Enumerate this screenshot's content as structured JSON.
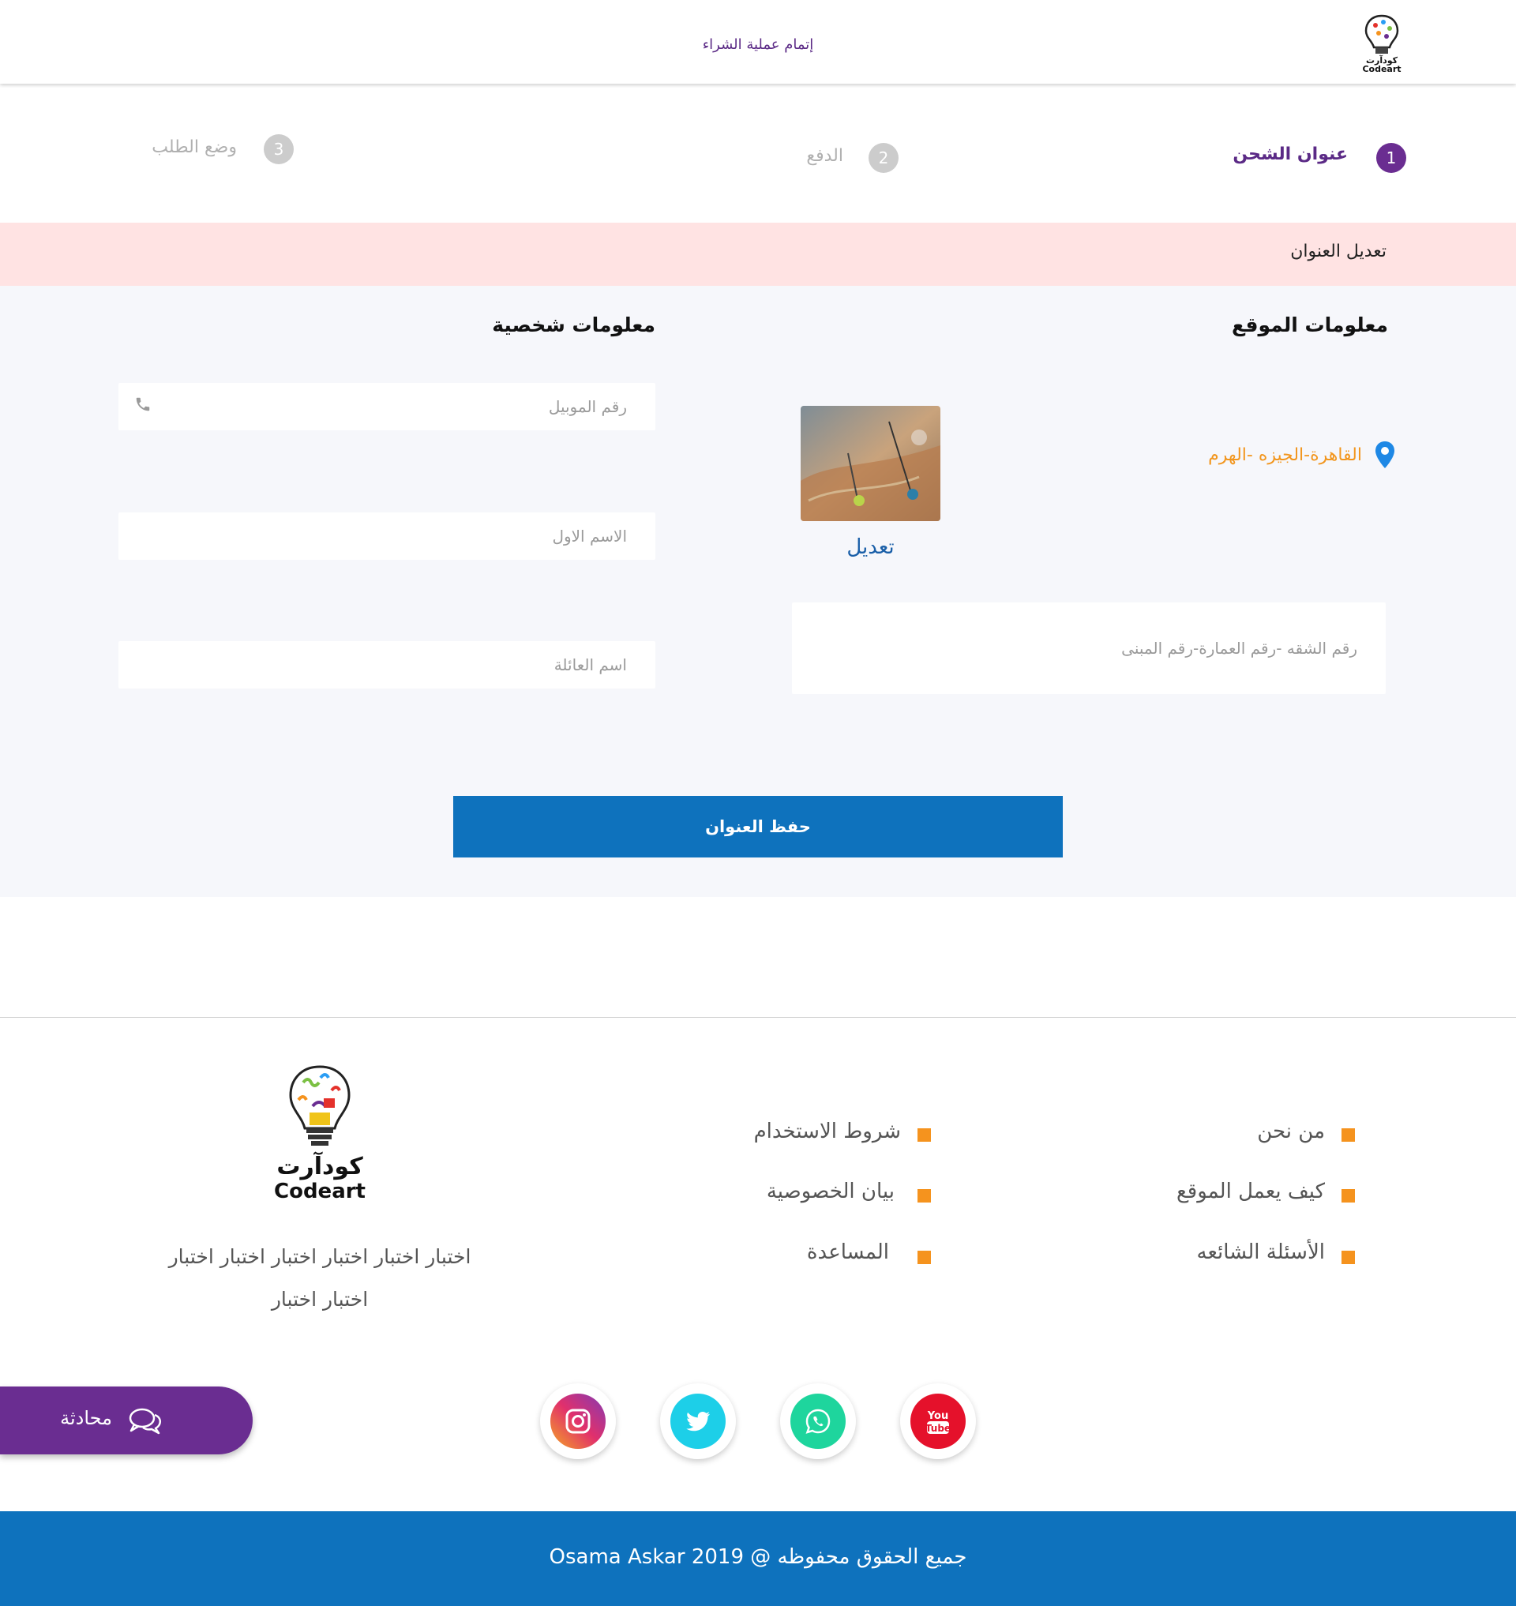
{
  "header": {
    "title": "إتمام عملية الشراء",
    "logo_ar": "كودآرت",
    "logo_en": "Codeart"
  },
  "steps": [
    {
      "number": "1",
      "label": "عنوان الشحن",
      "active": true
    },
    {
      "number": "2",
      "label": "الدفع",
      "active": false
    },
    {
      "number": "3",
      "label": "وضع الطلب",
      "active": false
    }
  ],
  "edit_band": {
    "text": "تعديل العنوان"
  },
  "location_info": {
    "title": "معلومات الموقع",
    "address": "القاهرة-الجيزه -الهرم",
    "edit_label": "تعديل",
    "details_placeholder": "رقم الشقه -رقم العمارة-رقم المبنى"
  },
  "personal_info": {
    "title": "معلومات شخصية",
    "mobile_placeholder": "رقم الموبيل",
    "first_name_placeholder": "الاسم الاول",
    "family_name_placeholder": "اسم العائلة"
  },
  "save_button": "حفظ العنوان",
  "footer": {
    "links_col1": [
      "من نحن",
      "كيف يعمل الموقع",
      "الأسئلة الشائعه"
    ],
    "links_col2": [
      "شروط الاستخدام",
      "بيان الخصوصية",
      "المساعدة"
    ],
    "logo_ar": "كودآرت",
    "logo_en": "Codeart",
    "about_text": "اختبار اختبار اختبار اختبار اختبار اختبار اختبار اختبار",
    "chat_label": "محادثة",
    "copyright": "جميع الحقوق محفوظه @ 2019 Osama Askar",
    "colors": {
      "primary": "#0e72bd",
      "accent": "#f5931e",
      "purple": "#6a2d91",
      "active_step": "#6a2d91",
      "inactive_step": "#cccccc"
    }
  },
  "social_icons": [
    "youtube-icon",
    "whatsapp-icon",
    "twitter-icon",
    "instagram-icon"
  ]
}
